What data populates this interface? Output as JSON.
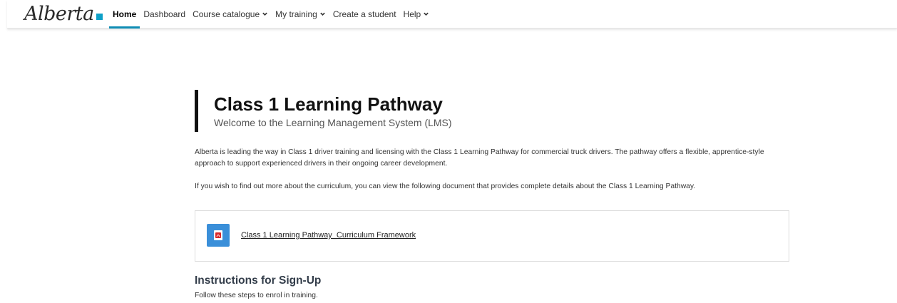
{
  "header": {
    "logo_text": "Alberta",
    "nav": [
      {
        "label": "Home",
        "active": true,
        "dropdown": false
      },
      {
        "label": "Dashboard",
        "active": false,
        "dropdown": false
      },
      {
        "label": "Course catalogue",
        "active": false,
        "dropdown": true
      },
      {
        "label": "My training",
        "active": false,
        "dropdown": true
      },
      {
        "label": "Create a student",
        "active": false,
        "dropdown": false
      },
      {
        "label": "Help",
        "active": false,
        "dropdown": true
      }
    ]
  },
  "hero": {
    "title": "Class 1 Learning Pathway",
    "subtitle": "Welcome to the Learning Management System (LMS)"
  },
  "intro": {
    "paragraph1": "Alberta is leading the way in Class 1 driver training and licensing with the Class 1 Learning Pathway for commercial truck drivers. The pathway offers a flexible, apprentice-style approach to support experienced drivers in their ongoing career development.",
    "paragraph2": "If you wish to find out more about the curriculum, you can view the following document that provides complete details about the Class 1 Learning Pathway."
  },
  "document": {
    "icon": "pdf-file-icon",
    "link_text": "Class 1 Learning Pathway_Curriculum Framework"
  },
  "instructions": {
    "title": "Instructions for Sign-Up",
    "text": "Follow these steps to enrol in training."
  },
  "colors": {
    "accent": "#0f8cb4",
    "logo_square": "#0ea0c8",
    "doc_icon_bg": "#3a8fd9",
    "pdf_red": "#d9292b"
  }
}
